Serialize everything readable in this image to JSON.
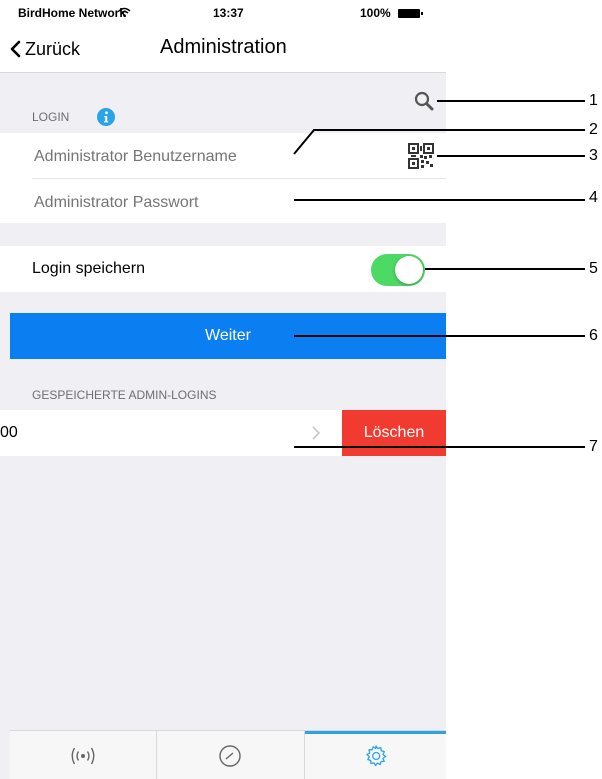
{
  "statusbar": {
    "carrier": "BirdHome Network",
    "time": "13:37",
    "battery": "100%"
  },
  "navbar": {
    "back_label": "Zurück",
    "title": "Administration"
  },
  "login": {
    "section_label": "LOGIN",
    "username_placeholder": "Administrator Benutzername",
    "password_placeholder": "Administrator Passwort",
    "save_label": "Login speichern",
    "save_enabled": true
  },
  "weiter_label": "Weiter",
  "saved": {
    "section_label": "GESPEICHERTE ADMIN-LOGINS",
    "items": [
      {
        "label": "00",
        "delete_label": "Löschen"
      }
    ]
  },
  "tabbar": {
    "active_tab": "settings"
  },
  "callouts": [
    "1",
    "2",
    "3",
    "4",
    "5",
    "6",
    "7"
  ],
  "colors": {
    "accent": "#0b7ff2",
    "delete": "#f23b30",
    "toggle_on": "#4cd964",
    "info": "#2aa3e8"
  }
}
